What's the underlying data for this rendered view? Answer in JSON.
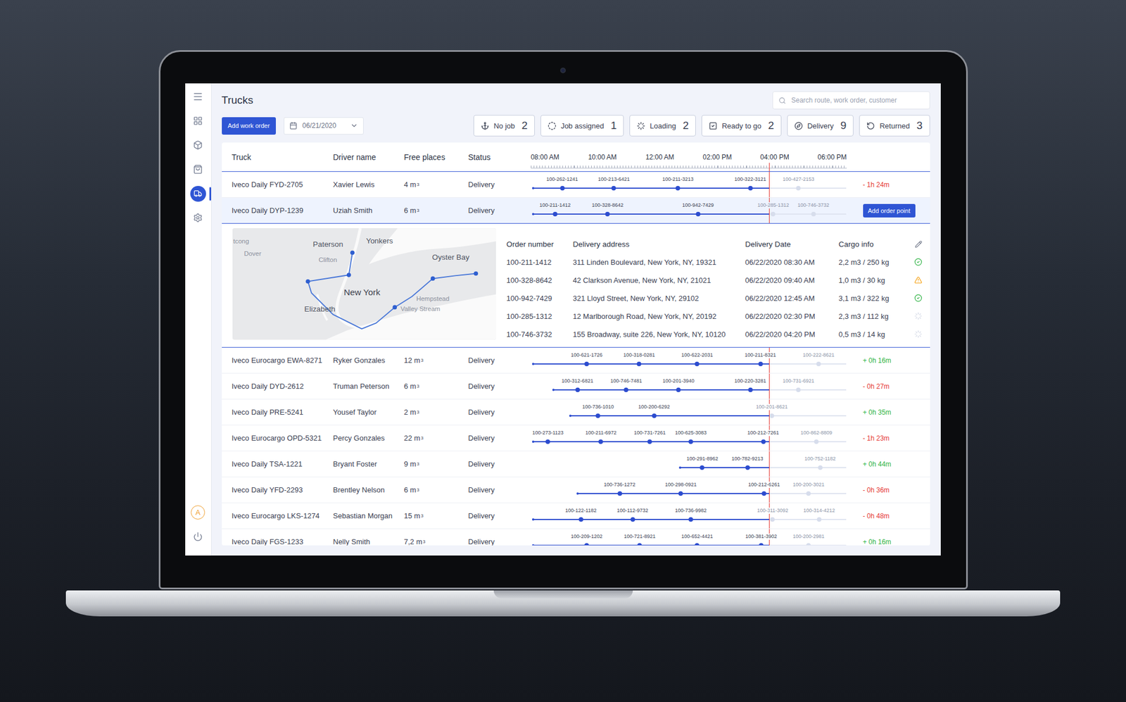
{
  "window": {
    "title": "Trucks"
  },
  "sidebar": {
    "items": [
      {
        "selected": false
      },
      {
        "selected": false
      },
      {
        "selected": false
      },
      {
        "selected": true
      },
      {
        "selected": false
      }
    ],
    "avatar": "A"
  },
  "toolbar": {
    "add_button": "Add work order",
    "date": "06/21/2020"
  },
  "search": {
    "placeholder": "Search route, work order, customer"
  },
  "filters": [
    {
      "label": "No job",
      "count": "2",
      "selected": false
    },
    {
      "label": "Job assigned",
      "count": "1",
      "selected": false
    },
    {
      "label": "Loading",
      "count": "2",
      "selected": false
    },
    {
      "label": "Ready to go",
      "count": "2",
      "selected": false
    },
    {
      "label": "Delivery",
      "count": "9",
      "selected": false
    },
    {
      "label": "Returned",
      "count": "3",
      "selected": false
    }
  ],
  "table": {
    "columns": [
      "Truck",
      "Driver name",
      "Free places",
      "Status"
    ],
    "axis": {
      "start": 7.5,
      "end": 18.5,
      "now": 15.8,
      "ticks": [
        {
          "label": "08:00 AM",
          "hour": 8
        },
        {
          "label": "10:00 AM",
          "hour": 10
        },
        {
          "label": "12:00 AM",
          "hour": 12
        },
        {
          "label": "02:00 PM",
          "hour": 14
        },
        {
          "label": "04:00 PM",
          "hour": 16
        },
        {
          "label": "06:00 PM",
          "hour": 18
        }
      ]
    },
    "rows": [
      {
        "truck": "Iveco Daily FYD-2705",
        "driver": "Xavier Lewis",
        "free": "4 m",
        "free_sup": "3",
        "status": "Delivery",
        "selected": false,
        "expanded": false,
        "start": 7.58,
        "stops": [
          {
            "label": "100-262-1241",
            "hour": 8.6,
            "done": true
          },
          {
            "label": "100-213-6421",
            "hour": 10.4,
            "done": true
          },
          {
            "label": "100-211-3213",
            "hour": 12.63,
            "done": true
          },
          {
            "label": "100-322-3121",
            "hour": 15.15,
            "done": true
          },
          {
            "label": "100-427-2153",
            "hour": 16.83,
            "done": false
          }
        ],
        "delta": "- 1h 24m",
        "color": "#e53935"
      },
      {
        "truck": "Iveco Daily DYP-1239",
        "driver": "Uziah Smith",
        "free": "6 m",
        "free_sup": "3",
        "status": "Delivery",
        "selected": true,
        "expanded": true,
        "start": 7.58,
        "stops": [
          {
            "label": "100-211-1412",
            "hour": 8.35,
            "done": true
          },
          {
            "label": "100-328-8642",
            "hour": 10.18,
            "done": true
          },
          {
            "label": "100-942-7429",
            "hour": 13.33,
            "done": true
          },
          {
            "label": "100-285-1312",
            "hour": 15.95,
            "done": false
          },
          {
            "label": "100-746-3732",
            "hour": 17.35,
            "done": false
          }
        ],
        "action": "Add order point"
      },
      {
        "truck": "Iveco Eurocargo EWA-8271",
        "driver": "Ryker Gonzales",
        "free": "12 m",
        "free_sup": "3",
        "status": "Delivery",
        "selected": false,
        "expanded": false,
        "start": 7.58,
        "stops": [
          {
            "label": "100-621-1726",
            "hour": 9.45,
            "done": true
          },
          {
            "label": "100-318-0281",
            "hour": 11.28,
            "done": true
          },
          {
            "label": "100-622-2031",
            "hour": 13.3,
            "done": true
          },
          {
            "label": "100-211-8321",
            "hour": 15.5,
            "done": true
          },
          {
            "label": "100-222-8621",
            "hour": 17.53,
            "done": false
          }
        ],
        "delta": "+ 0h 16m",
        "color": "#2fb344"
      },
      {
        "truck": "Iveco Daily DYD-2612",
        "driver": "Truman Peterson",
        "free": "6 m",
        "free_sup": "3",
        "status": "Delivery",
        "selected": false,
        "expanded": false,
        "start": 8.3,
        "stops": [
          {
            "label": "100-312-6821",
            "hour": 9.13,
            "done": true
          },
          {
            "label": "100-746-7481",
            "hour": 10.83,
            "done": true
          },
          {
            "label": "100-201-3940",
            "hour": 12.65,
            "done": true
          },
          {
            "label": "100-220-3281",
            "hour": 15.15,
            "done": true
          },
          {
            "label": "100-731-6921",
            "hour": 16.83,
            "done": false
          }
        ],
        "delta": "- 0h 27m",
        "color": "#e53935"
      },
      {
        "truck": "Iveco Daily PRE-5241",
        "driver": "Yousef Taylor",
        "free": "2 m",
        "free_sup": "3",
        "status": "Delivery",
        "selected": false,
        "expanded": false,
        "start": 8.88,
        "stops": [
          {
            "label": "100-736-1010",
            "hour": 9.85,
            "done": true
          },
          {
            "label": "100-200-6292",
            "hour": 11.8,
            "done": true
          },
          {
            "label": "100-201-8621",
            "hour": 15.9,
            "done": false
          }
        ],
        "delta": "+ 0h 35m",
        "color": "#2fb344"
      },
      {
        "truck": "Iveco Eurocargo OPD-5321",
        "driver": "Percy Gonzales",
        "free": "22 m",
        "free_sup": "3",
        "status": "Delivery",
        "selected": false,
        "expanded": false,
        "start": 7.58,
        "stops": [
          {
            "label": "100-273-1123",
            "hour": 8.1,
            "done": true
          },
          {
            "label": "100-211-6972",
            "hour": 9.95,
            "done": true
          },
          {
            "label": "100-731-7261",
            "hour": 11.65,
            "done": true
          },
          {
            "label": "100-625-3083",
            "hour": 13.08,
            "done": true
          },
          {
            "label": "100-212-7261",
            "hour": 15.6,
            "done": true
          },
          {
            "label": "100-862-8809",
            "hour": 17.45,
            "done": false
          }
        ],
        "delta": "- 1h 23m",
        "color": "#e53935"
      },
      {
        "truck": "Iveco Daily TSA-1221",
        "driver": "Bryant Foster",
        "free": "9 m",
        "free_sup": "3",
        "status": "Delivery",
        "selected": false,
        "expanded": false,
        "start": 12.7,
        "stops": [
          {
            "label": "100-291-8962",
            "hour": 13.48,
            "done": true
          },
          {
            "label": "100-782-9213",
            "hour": 15.05,
            "done": true
          },
          {
            "label": "100-752-1182",
            "hour": 17.58,
            "done": false
          }
        ],
        "delta": "+ 0h 44m",
        "color": "#2fb344"
      },
      {
        "truck": "Iveco Daily YFD-2293",
        "driver": "Brentley Nelson",
        "free": "6 m",
        "free_sup": "3",
        "status": "Delivery",
        "selected": false,
        "expanded": false,
        "start": 9.13,
        "stops": [
          {
            "label": "100-736-1272",
            "hour": 10.6,
            "done": true
          },
          {
            "label": "100-298-0921",
            "hour": 12.73,
            "done": true
          },
          {
            "label": "100-212-6261",
            "hour": 15.63,
            "done": true
          },
          {
            "label": "100-200-3021",
            "hour": 17.18,
            "done": false
          }
        ],
        "delta": "- 0h 36m",
        "color": "#e53935"
      },
      {
        "truck": "Iveco Eurocargo LKS-1274",
        "driver": "Sebastian Morgan",
        "free": "15 m",
        "free_sup": "3",
        "status": "Delivery",
        "selected": false,
        "expanded": false,
        "start": 7.58,
        "stops": [
          {
            "label": "100-122-1182",
            "hour": 9.25,
            "done": true
          },
          {
            "label": "100-112-9732",
            "hour": 11.05,
            "done": true
          },
          {
            "label": "100-736-9982",
            "hour": 13.08,
            "done": true
          },
          {
            "label": "100-311-3092",
            "hour": 15.93,
            "done": false
          },
          {
            "label": "100-314-4212",
            "hour": 17.55,
            "done": false
          }
        ],
        "delta": "- 0h 48m",
        "color": "#e53935"
      },
      {
        "truck": "Iveco Daily FGS-1233",
        "driver": "Nelly Smith",
        "free": "7,2 m",
        "free_sup": "3",
        "status": "Delivery",
        "selected": false,
        "expanded": false,
        "start": 7.58,
        "stops": [
          {
            "label": "100-209-1202",
            "hour": 9.45,
            "done": true
          },
          {
            "label": "100-721-8921",
            "hour": 11.3,
            "done": true
          },
          {
            "label": "100-652-4421",
            "hour": 13.3,
            "done": true
          },
          {
            "label": "100-381-3902",
            "hour": 15.53,
            "done": true
          },
          {
            "label": "100-200-2981",
            "hour": 17.18,
            "done": false
          }
        ],
        "delta": "+ 0h 16m",
        "color": "#2fb344"
      }
    ]
  },
  "details": {
    "columns": [
      "Order number",
      "Delivery address",
      "Delivery Date",
      "Cargo info"
    ],
    "rows": [
      {
        "order": "100-211-1412",
        "address": "311 Linden Boulevard, New York, NY, 19321",
        "date": "06/22/2020 08:30 AM",
        "cargo": "2,2 m3 / 250 kg",
        "kind": "done"
      },
      {
        "order": "100-328-8642",
        "address": "42 Clarkson Avenue, New York, NY, 21021",
        "date": "06/22/2020 09:40 AM",
        "cargo": "1,0 m3 / 30 kg",
        "kind": "warning"
      },
      {
        "order": "100-942-7429",
        "address": "321 Lloyd Street, New York, NY, 29102",
        "date": "06/22/2020 12:45 AM",
        "cargo": "3,1 m3 / 322 kg",
        "kind": "done"
      },
      {
        "order": "100-285-1312",
        "address": "12 Marlborough Road, New York, NY, 20192",
        "date": "06/22/2020 02:30 PM",
        "cargo": "2,3 m3 / 112 kg",
        "kind": "pending"
      },
      {
        "order": "100-746-3732",
        "address": "155 Broadway, suite 226, New York, NY, 10120",
        "date": "06/22/2020 04:20 PM",
        "cargo": "0,5 m3 / 14 kg",
        "kind": "pending"
      }
    ]
  },
  "map": {
    "labels": [
      "tcong",
      "Paterson",
      "Yonkers",
      "Dover",
      "Clifton",
      "Oyster Bay",
      "New York",
      "Hempstead",
      "Elizabeth",
      "Valley Stream"
    ]
  }
}
